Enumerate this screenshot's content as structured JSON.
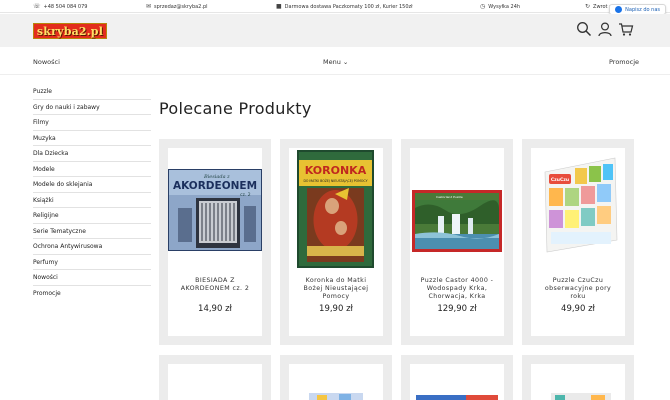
{
  "topbar": {
    "phone": "+48 504 084 079",
    "email": "sprzedaz@skryba2.pl",
    "delivery": "Darmowa dostawa Paczkomaty 100 zł, Kurier 150zł",
    "shipping": "Wysyłka 24h",
    "returns": "Zwrot w",
    "chat": "Napisz do nas"
  },
  "logo": "skryba2.pl",
  "nav": {
    "new": "Nowości",
    "menu": "Menu ⌄",
    "promo": "Promocje"
  },
  "sidebar": {
    "items": [
      "Puzzle",
      "Gry do nauki i zabawy",
      "Filmy",
      "Muzyka",
      "Dla Dziecka",
      "Modele",
      "Modele do sklejania",
      "Książki",
      "Religijne",
      "Serie Tematyczne",
      "Ochrona Antywirusowa",
      "Perfumy",
      "Nowości",
      "Promocje"
    ]
  },
  "main": {
    "title": "Polecane Produkty",
    "products": [
      {
        "name": "BIESIADA Z AKORDEONEM cz. 2",
        "price": "14,90 zł",
        "cover_title": "AKORDEONEM",
        "cover_top": "Biesiada z",
        "cover_sub": "cz. 2"
      },
      {
        "name": "Koronka do Matki Bożej Nieustającej Pomocy",
        "price": "19,90 zł",
        "cover_title": "KORONKA",
        "cover_sub": "DO MATKI BOŻEJ NIEUSTAJĄCEJ POMOCY"
      },
      {
        "name": "Puzzle Castor 4000 - Wodospady Krka, Chorwacja, Krka",
        "price": "129,90 zł",
        "cover_brand": "Castorland Puzzle"
      },
      {
        "name": "Puzzle CzuCzu obserwacyjne pory roku",
        "price": "49,90 zł",
        "cover_brand": "CzuCzu"
      }
    ]
  }
}
